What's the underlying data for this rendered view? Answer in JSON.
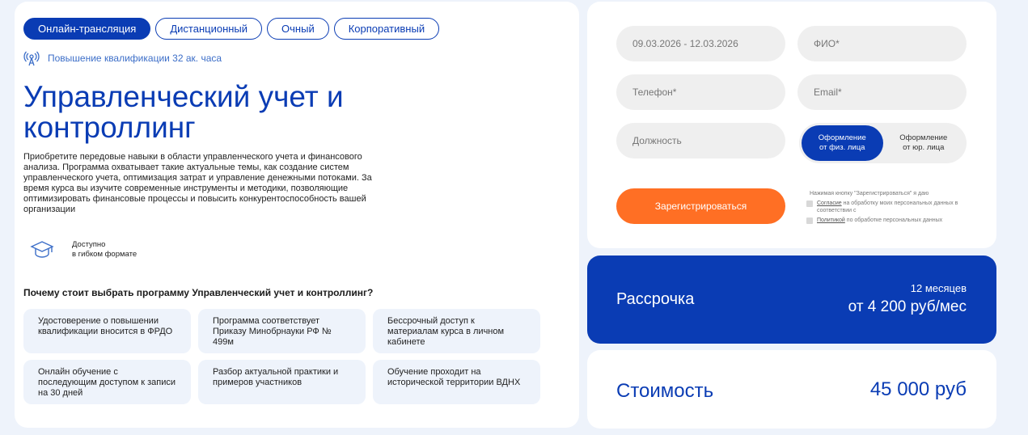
{
  "course": {
    "tabs": [
      {
        "label": "Онлайн-трансляция",
        "active": true
      },
      {
        "label": "Дистанционный",
        "active": false
      },
      {
        "label": "Очный",
        "active": false
      },
      {
        "label": "Корпоративный",
        "active": false
      }
    ],
    "qualification": "Повышение квалификации 32 ак. часа",
    "title": "Управленческий учет и контроллинг",
    "description": "Приобретите передовые навыки в области управленческого учета и финансового анализа. Программа охватывает такие актуальные темы, как создание систем управленческого учета, оптимизация затрат и управление денежными потоками. За время курса вы изучите современные инструменты и методики, позволяющие оптимизировать финансовые процессы и повысить конкурентоспособность вашей организации",
    "format_line1": "Доступно",
    "format_line2": "в гибком формате",
    "why_heading": "Почему стоит выбрать программу Управленческий учет и контроллинг?",
    "features": [
      "Удостоверение о повышении квалификации вносится в ФРДО",
      "Программа соответствует Приказу Минобрнауки РФ № 499м",
      "Бессрочный доступ к материалам курса в личном кабинете",
      "Онлайн обучение с последующим доступом к записи на 30 дней",
      "Разбор актуальной практики и примеров участников",
      "Обучение проходит на исторической территории ВДНХ"
    ]
  },
  "form": {
    "dates_value": "09.03.2026 - 12.03.2026",
    "name_placeholder": "ФИО*",
    "phone_placeholder": "Телефон*",
    "email_placeholder": "Email*",
    "position_placeholder": "Должность",
    "entity_individual_l1": "Оформление",
    "entity_individual_l2": "от физ. лица",
    "entity_legal_l1": "Оформление",
    "entity_legal_l2": "от юр. лица",
    "register_label": "Зарегистрироваться",
    "consent_intro": "Нажимая кнопку \"Зарегистрироваться\" я даю",
    "consent_link1": "Согласие",
    "consent_text1": " на обработку моих персональных данных в соответствии с",
    "consent_link2": "Политикой",
    "consent_text2": " по обработке персональных данных"
  },
  "installment": {
    "label": "Рассрочка",
    "months": "12 месяцев",
    "amount": "от 4 200 руб/мес"
  },
  "price": {
    "label": "Стоимость",
    "value": "45 000 руб"
  },
  "colors": {
    "accent": "#0a3cb4",
    "button": "#ff6f24",
    "background": "#eef3fb"
  }
}
